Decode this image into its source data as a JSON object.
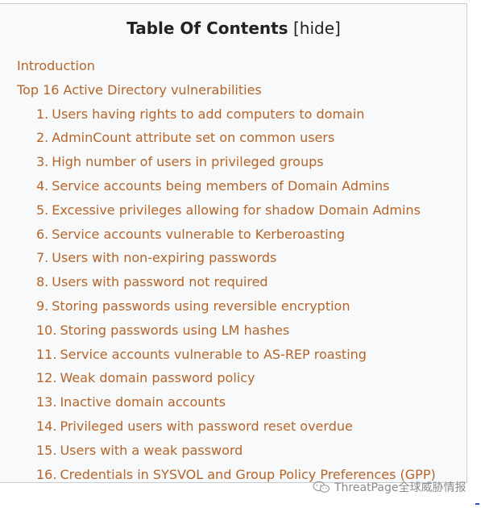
{
  "toc": {
    "title": "Table Of Contents",
    "hide_open": " [",
    "hide_label": "hide",
    "hide_close": "]",
    "link_color": "#b5652a",
    "top_items": [
      {
        "label": "Introduction"
      },
      {
        "label": "Top 16 Active Directory vulnerabilities"
      }
    ],
    "sub_items": [
      {
        "num": "1.",
        "label": "Users having rights to add computers to domain"
      },
      {
        "num": "2.",
        "label": "AdminCount attribute set on common users"
      },
      {
        "num": "3.",
        "label": "High number of users in privileged groups"
      },
      {
        "num": "4.",
        "label": "Service accounts being members of Domain Admins"
      },
      {
        "num": "5.",
        "label": "Excessive privileges allowing for shadow Domain Admins"
      },
      {
        "num": "6.",
        "label": "Service accounts vulnerable to Kerberoasting"
      },
      {
        "num": "7.",
        "label": "Users with non-expiring passwords"
      },
      {
        "num": "8.",
        "label": "Users with password not required"
      },
      {
        "num": "9.",
        "label": "Storing passwords using reversible encryption"
      },
      {
        "num": "10.",
        "label": "Storing passwords using LM hashes"
      },
      {
        "num": "11.",
        "label": "Service accounts vulnerable to AS-REP roasting"
      },
      {
        "num": "12.",
        "label": "Weak domain password policy"
      },
      {
        "num": "13.",
        "label": "Inactive domain accounts"
      },
      {
        "num": "14.",
        "label": "Privileged users with password reset overdue"
      },
      {
        "num": "15.",
        "label": "Users with a weak password"
      },
      {
        "num": "16.",
        "label": "Credentials in SYSVOL and Group Policy Preferences (GPP)"
      }
    ]
  },
  "watermark": {
    "icon": "wechat-icon",
    "text": "ThreatPage全球威胁情报"
  }
}
